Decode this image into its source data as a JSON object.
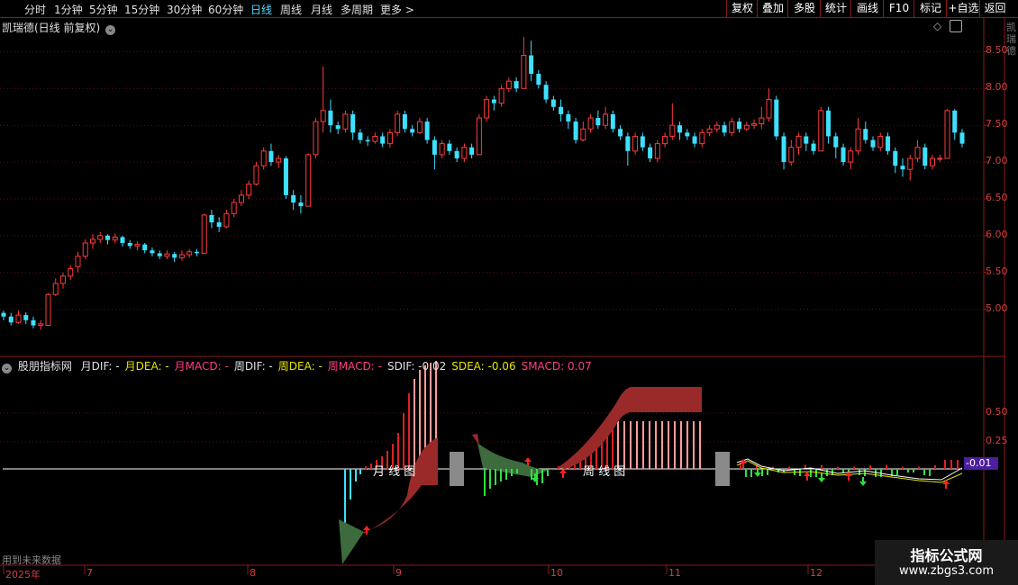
{
  "toolbar": {
    "periods": [
      "分时",
      "1分钟",
      "5分钟",
      "15分钟",
      "30分钟",
      "60分钟",
      "日线",
      "周线",
      "月线",
      "多周期",
      "更多 >"
    ],
    "active_period": "日线",
    "right_buttons": [
      "复权",
      "叠加",
      "多股",
      "统计",
      "画线",
      "F10",
      "标记",
      "+自选",
      "返回"
    ]
  },
  "main_panel": {
    "title": "凯瑞德(日线 前复权)",
    "y_ticks": [
      "8.50",
      "8.00",
      "7.50",
      "7.00",
      "6.50",
      "6.00",
      "5.50",
      "5.00"
    ]
  },
  "indicator_panel": {
    "name": "股朋指标网",
    "legend": [
      {
        "text": "月DIF: -",
        "color": "#e0e0e0"
      },
      {
        "text": "月DEA: -",
        "color": "#e6e600"
      },
      {
        "text": "月MACD: -",
        "color": "#ff3f7f"
      },
      {
        "text": "周DIF: -",
        "color": "#e0e0e0"
      },
      {
        "text": "周DEA: -",
        "color": "#e6e600"
      },
      {
        "text": "周MACD: -",
        "color": "#ff3f7f"
      },
      {
        "text": "SDIF: -0.02",
        "color": "#e0e0e0"
      },
      {
        "text": "SDEA: -0.06",
        "color": "#e6e600"
      },
      {
        "text": "SMACD: 0.07",
        "color": "#ff3f7f"
      }
    ],
    "y_ticks": [
      "0.50",
      "0.25"
    ],
    "current_value": "-0.01",
    "monthly_label": "月 线 图",
    "weekly_label": "周 线 图",
    "footnote": "用到未来数据"
  },
  "x_axis": {
    "labels": [
      "2025年",
      "7",
      "8",
      "9",
      "10",
      "11",
      "12"
    ]
  },
  "right_sidebar_text": "凯瑞德",
  "watermark": {
    "title": "指标公式网",
    "url": "www.zbgs3.com"
  },
  "chart_data": {
    "type": "candlestick",
    "y_range": [
      4.75,
      8.75
    ],
    "colors": {
      "up": "#ff3b3b",
      "down": "#3ee0ff"
    },
    "candles": [
      [
        4.95,
        4.9,
        4.98,
        4.85
      ],
      [
        4.9,
        4.82,
        4.95,
        4.78
      ],
      [
        4.82,
        4.92,
        4.98,
        4.8
      ],
      [
        4.92,
        4.85,
        4.96,
        4.8
      ],
      [
        4.85,
        4.78,
        4.9,
        4.74
      ],
      [
        4.78,
        4.8,
        4.85,
        4.72
      ],
      [
        4.78,
        5.2,
        5.22,
        4.78
      ],
      [
        5.2,
        5.35,
        5.42,
        5.18
      ],
      [
        5.35,
        5.45,
        5.5,
        5.28
      ],
      [
        5.45,
        5.55,
        5.6,
        5.4
      ],
      [
        5.58,
        5.72,
        5.78,
        5.5
      ],
      [
        5.72,
        5.9,
        5.95,
        5.68
      ],
      [
        5.9,
        5.95,
        6.02,
        5.82
      ],
      [
        5.95,
        6.0,
        6.05,
        5.9
      ],
      [
        6.0,
        5.94,
        6.02,
        5.88
      ],
      [
        5.94,
        5.98,
        6.03,
        5.9
      ],
      [
        5.98,
        5.9,
        6.0,
        5.85
      ],
      [
        5.9,
        5.86,
        5.94,
        5.82
      ],
      [
        5.86,
        5.88,
        5.92,
        5.8
      ],
      [
        5.88,
        5.8,
        5.9,
        5.76
      ],
      [
        5.8,
        5.76,
        5.84,
        5.72
      ],
      [
        5.76,
        5.72,
        5.8,
        5.68
      ],
      [
        5.72,
        5.75,
        5.8,
        5.68
      ],
      [
        5.75,
        5.7,
        5.78,
        5.64
      ],
      [
        5.7,
        5.74,
        5.8,
        5.66
      ],
      [
        5.74,
        5.78,
        5.82,
        5.7
      ],
      [
        5.78,
        5.76,
        5.82,
        5.72
      ],
      [
        5.76,
        6.28,
        6.3,
        5.76
      ],
      [
        6.28,
        6.18,
        6.35,
        6.1
      ],
      [
        6.18,
        6.12,
        6.25,
        6.05
      ],
      [
        6.12,
        6.3,
        6.35,
        6.1
      ],
      [
        6.3,
        6.45,
        6.5,
        6.25
      ],
      [
        6.45,
        6.55,
        6.62,
        6.4
      ],
      [
        6.55,
        6.7,
        6.75,
        6.5
      ],
      [
        6.7,
        6.95,
        7.0,
        6.68
      ],
      [
        6.95,
        7.15,
        7.2,
        6.9
      ],
      [
        7.15,
        7.0,
        7.25,
        6.95
      ],
      [
        7.0,
        7.05,
        7.1,
        6.92
      ],
      [
        7.05,
        6.55,
        7.08,
        6.5
      ],
      [
        6.55,
        6.45,
        6.62,
        6.35
      ],
      [
        6.45,
        6.4,
        6.55,
        6.3
      ],
      [
        6.4,
        7.1,
        7.12,
        6.4
      ],
      [
        7.1,
        7.55,
        7.6,
        7.05
      ],
      [
        7.55,
        7.7,
        8.3,
        7.4
      ],
      [
        7.7,
        7.5,
        7.85,
        7.4
      ],
      [
        7.5,
        7.45,
        7.55,
        7.38
      ],
      [
        7.45,
        7.65,
        7.7,
        7.4
      ],
      [
        7.65,
        7.4,
        7.7,
        7.3
      ],
      [
        7.4,
        7.3,
        7.45,
        7.25
      ],
      [
        7.3,
        7.28,
        7.35,
        7.22
      ],
      [
        7.28,
        7.35,
        7.4,
        7.25
      ],
      [
        7.35,
        7.25,
        7.4,
        7.2
      ],
      [
        7.25,
        7.4,
        7.45,
        7.2
      ],
      [
        7.4,
        7.65,
        7.7,
        7.35
      ],
      [
        7.65,
        7.45,
        7.7,
        7.4
      ],
      [
        7.45,
        7.4,
        7.5,
        7.35
      ],
      [
        7.4,
        7.55,
        7.6,
        7.38
      ],
      [
        7.55,
        7.3,
        7.6,
        7.25
      ],
      [
        7.3,
        7.1,
        7.35,
        6.9
      ],
      [
        7.1,
        7.25,
        7.3,
        7.05
      ],
      [
        7.25,
        7.15,
        7.3,
        7.1
      ],
      [
        7.15,
        7.05,
        7.2,
        7.0
      ],
      [
        7.05,
        7.2,
        7.25,
        7.0
      ],
      [
        7.2,
        7.1,
        7.25,
        7.05
      ],
      [
        7.1,
        7.6,
        7.65,
        7.1
      ],
      [
        7.6,
        7.85,
        7.9,
        7.55
      ],
      [
        7.85,
        7.8,
        7.9,
        7.7
      ],
      [
        7.8,
        8.0,
        8.05,
        7.75
      ],
      [
        8.0,
        8.1,
        8.15,
        7.95
      ],
      [
        8.1,
        8.0,
        8.15,
        7.95
      ],
      [
        8.0,
        8.45,
        8.7,
        8.0
      ],
      [
        8.45,
        8.2,
        8.65,
        8.1
      ],
      [
        8.2,
        8.05,
        8.25,
        8.0
      ],
      [
        8.05,
        7.85,
        8.1,
        7.8
      ],
      [
        7.85,
        7.75,
        7.9,
        7.7
      ],
      [
        7.75,
        7.65,
        7.85,
        7.55
      ],
      [
        7.65,
        7.55,
        7.7,
        7.45
      ],
      [
        7.55,
        7.3,
        7.6,
        7.25
      ],
      [
        7.3,
        7.45,
        7.55,
        7.28
      ],
      [
        7.45,
        7.6,
        7.65,
        7.4
      ],
      [
        7.6,
        7.5,
        7.7,
        7.45
      ],
      [
        7.5,
        7.65,
        7.75,
        7.45
      ],
      [
        7.65,
        7.45,
        7.7,
        7.4
      ],
      [
        7.45,
        7.35,
        7.5,
        7.3
      ],
      [
        7.35,
        7.15,
        7.4,
        6.95
      ],
      [
        7.15,
        7.35,
        7.4,
        7.1
      ],
      [
        7.35,
        7.2,
        7.4,
        7.15
      ],
      [
        7.2,
        7.05,
        7.25,
        7.0
      ],
      [
        7.05,
        7.25,
        7.3,
        7.0
      ],
      [
        7.25,
        7.35,
        7.4,
        7.2
      ],
      [
        7.35,
        7.5,
        7.8,
        7.3
      ],
      [
        7.5,
        7.4,
        7.55,
        7.3
      ],
      [
        7.4,
        7.35,
        7.45,
        7.3
      ],
      [
        7.35,
        7.25,
        7.4,
        7.2
      ],
      [
        7.25,
        7.4,
        7.45,
        7.2
      ],
      [
        7.4,
        7.45,
        7.5,
        7.35
      ],
      [
        7.45,
        7.5,
        7.55,
        7.4
      ],
      [
        7.5,
        7.4,
        7.55,
        7.35
      ],
      [
        7.4,
        7.55,
        7.6,
        7.35
      ],
      [
        7.55,
        7.45,
        7.6,
        7.4
      ],
      [
        7.45,
        7.5,
        7.55,
        7.42
      ],
      [
        7.5,
        7.52,
        7.58,
        7.45
      ],
      [
        7.52,
        7.6,
        7.75,
        7.45
      ],
      [
        7.6,
        7.85,
        8.0,
        7.55
      ],
      [
        7.85,
        7.35,
        7.9,
        7.3
      ],
      [
        7.35,
        7.0,
        7.4,
        6.9
      ],
      [
        7.0,
        7.2,
        7.3,
        6.95
      ],
      [
        7.2,
        7.35,
        7.4,
        7.1
      ],
      [
        7.35,
        7.25,
        7.4,
        7.15
      ],
      [
        7.25,
        7.15,
        7.3,
        7.1
      ],
      [
        7.15,
        7.7,
        7.75,
        7.15
      ],
      [
        7.7,
        7.35,
        7.75,
        7.25
      ],
      [
        7.35,
        7.2,
        7.4,
        7.05
      ],
      [
        7.2,
        7.0,
        7.25,
        6.95
      ],
      [
        7.0,
        7.15,
        7.2,
        6.9
      ],
      [
        7.15,
        7.45,
        7.6,
        7.1
      ],
      [
        7.45,
        7.3,
        7.55,
        7.25
      ],
      [
        7.3,
        7.2,
        7.35,
        7.15
      ],
      [
        7.2,
        7.35,
        7.4,
        7.15
      ],
      [
        7.35,
        7.15,
        7.4,
        7.1
      ],
      [
        7.15,
        6.95,
        7.2,
        6.85
      ],
      [
        6.95,
        6.9,
        7.05,
        6.8
      ],
      [
        6.9,
        7.05,
        7.1,
        6.75
      ],
      [
        7.05,
        7.2,
        7.3,
        7.0
      ],
      [
        7.2,
        6.95,
        7.25,
        6.9
      ],
      [
        6.95,
        7.05,
        7.1,
        6.9
      ],
      [
        7.05,
        7.05,
        7.1,
        7.0
      ],
      [
        7.05,
        7.7,
        7.72,
        7.05
      ],
      [
        7.7,
        7.4,
        7.72,
        7.3
      ],
      [
        7.4,
        7.25,
        7.45,
        7.2
      ]
    ]
  }
}
